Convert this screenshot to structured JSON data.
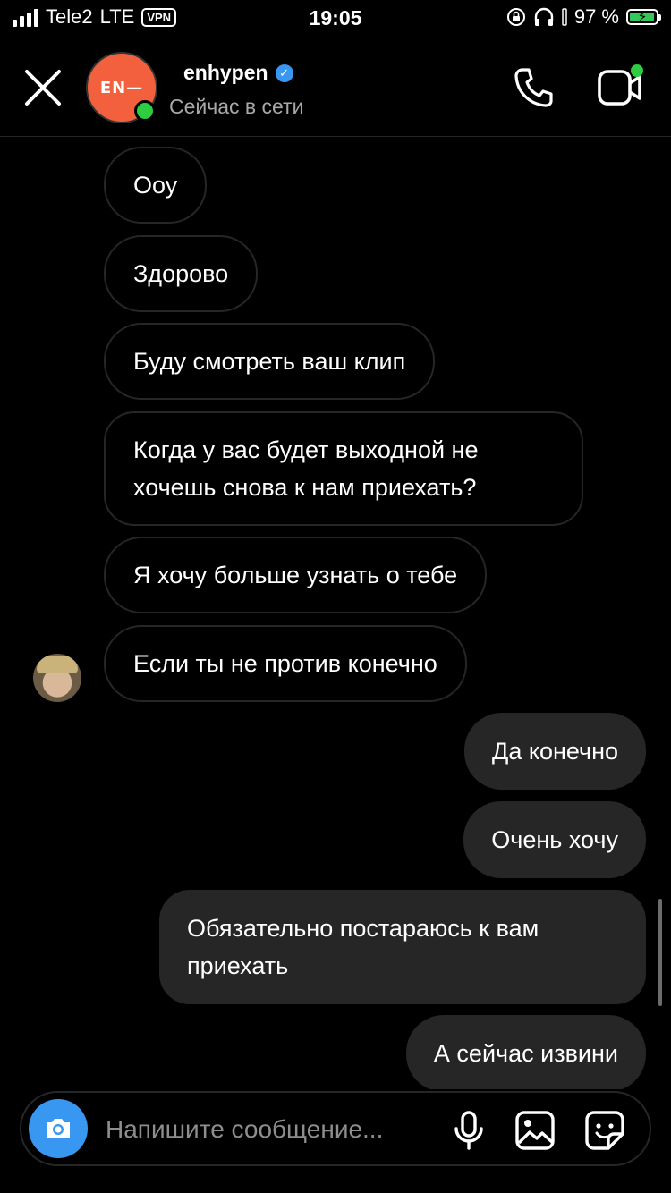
{
  "status_bar": {
    "carrier": "Tele2",
    "network": "LTE",
    "vpn": "VPN",
    "time": "19:05",
    "battery_percent": "97 %"
  },
  "header": {
    "contact_name": "enhypen",
    "avatar_text": "EN—",
    "status": "Сейчас в сети"
  },
  "messages": [
    {
      "direction": "in",
      "text": "Ооу"
    },
    {
      "direction": "in",
      "text": "Здорово"
    },
    {
      "direction": "in",
      "text": "Буду смотреть ваш клип"
    },
    {
      "direction": "in",
      "text": "Когда у вас будет выходной не хочешь снова к нам приехать?"
    },
    {
      "direction": "in",
      "text": "Я хочу больше узнать о тебе"
    },
    {
      "direction": "in",
      "text": "Если ты не против конечно"
    },
    {
      "direction": "out",
      "text": "Да конечно"
    },
    {
      "direction": "out",
      "text": "Очень хочу"
    },
    {
      "direction": "out",
      "text": "Обязательно постараюсь к вам приехать"
    },
    {
      "direction": "out",
      "text": "А сейчас извини"
    }
  ],
  "composer": {
    "placeholder": "Напишите сообщение..."
  },
  "icons": {
    "close": "close-icon",
    "call": "phone-icon",
    "video": "video-camera-icon",
    "camera": "camera-icon",
    "mic": "microphone-icon",
    "gallery": "gallery-icon",
    "sticker": "sticker-icon"
  },
  "colors": {
    "background": "#000000",
    "outgoing_bubble": "#262626",
    "incoming_border": "#262626",
    "online": "#2ecc40",
    "verified": "#3897f0",
    "camera_button": "#3897f0",
    "avatar_bg": "#f2603d"
  }
}
